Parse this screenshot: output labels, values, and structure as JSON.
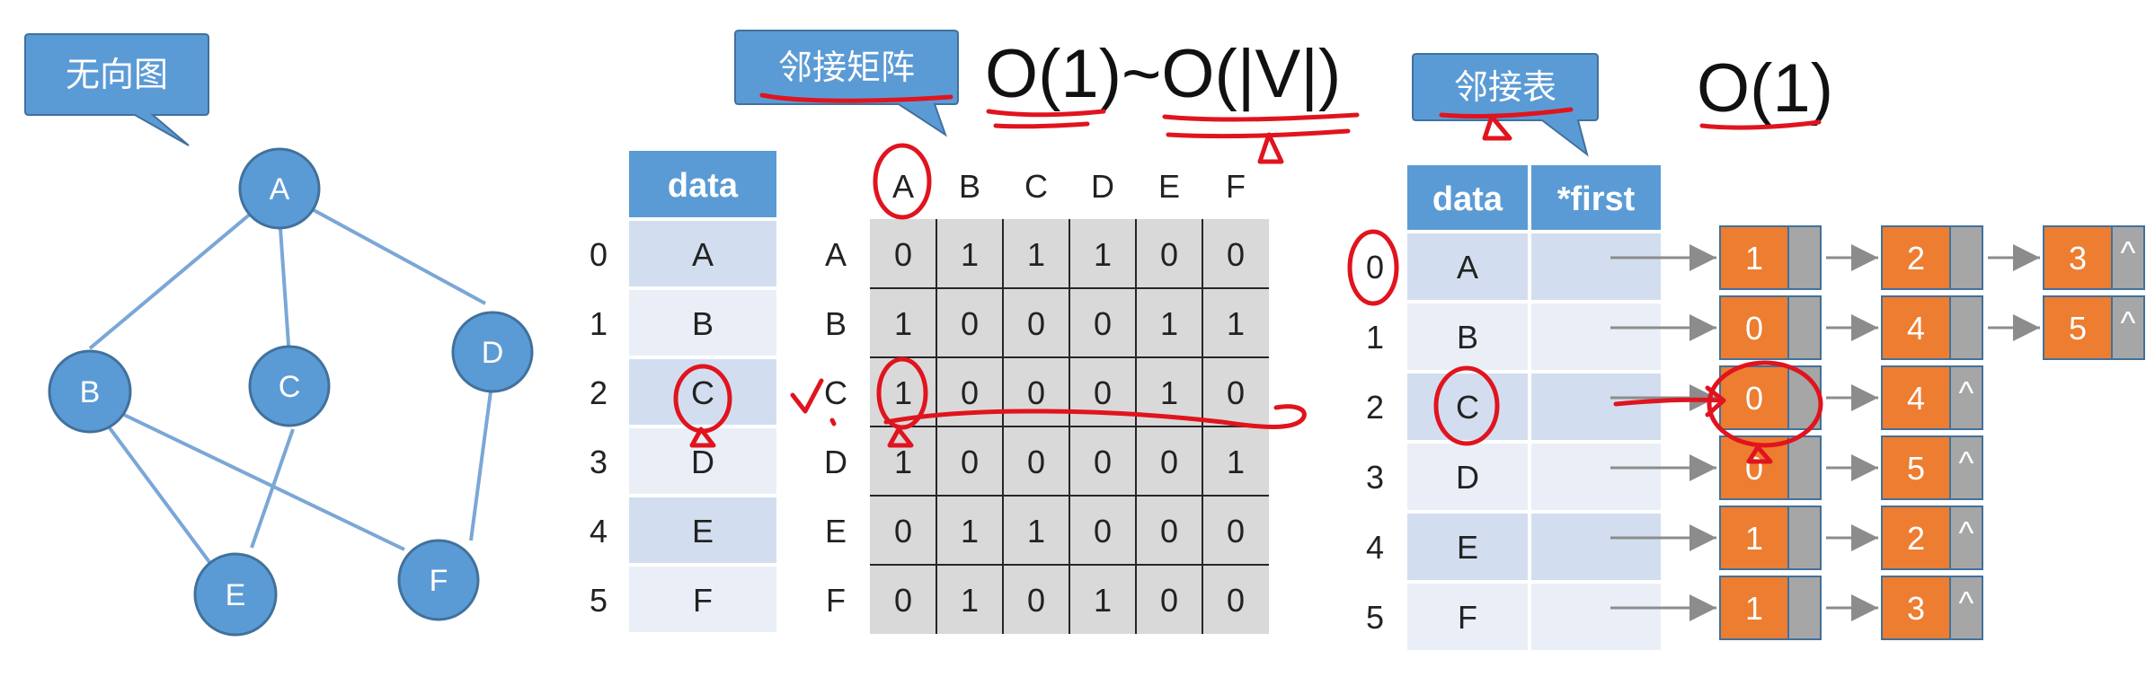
{
  "callouts": {
    "undirected_graph": "无向图",
    "adjacency_matrix": "邻接矩阵",
    "adjacency_list": "邻接表"
  },
  "complexity": {
    "matrix": "O(1)~O(|V|)",
    "list": "O(1)"
  },
  "graph": {
    "nodes": [
      "A",
      "B",
      "C",
      "D",
      "E",
      "F"
    ],
    "edges": [
      [
        "A",
        "B"
      ],
      [
        "A",
        "C"
      ],
      [
        "A",
        "D"
      ],
      [
        "B",
        "E"
      ],
      [
        "B",
        "F"
      ],
      [
        "C",
        "E"
      ],
      [
        "D",
        "F"
      ]
    ]
  },
  "vertex_table": {
    "header": "data",
    "indices": [
      "0",
      "1",
      "2",
      "3",
      "4",
      "5"
    ],
    "rows": [
      "A",
      "B",
      "C",
      "D",
      "E",
      "F"
    ]
  },
  "matrix": {
    "col_headers": [
      "A",
      "B",
      "C",
      "D",
      "E",
      "F"
    ],
    "row_headers": [
      "A",
      "B",
      "C",
      "D",
      "E",
      "F"
    ],
    "rows": [
      [
        "0",
        "1",
        "1",
        "1",
        "0",
        "0"
      ],
      [
        "1",
        "0",
        "0",
        "0",
        "1",
        "1"
      ],
      [
        "1",
        "0",
        "0",
        "0",
        "1",
        "0"
      ],
      [
        "1",
        "0",
        "0",
        "0",
        "0",
        "1"
      ],
      [
        "0",
        "1",
        "1",
        "0",
        "0",
        "0"
      ],
      [
        "0",
        "1",
        "0",
        "1",
        "0",
        "0"
      ]
    ]
  },
  "adj_list": {
    "headers": [
      "data",
      "*first"
    ],
    "indices": [
      "0",
      "1",
      "2",
      "3",
      "4",
      "5"
    ],
    "vertices": [
      "A",
      "B",
      "C",
      "D",
      "E",
      "F"
    ],
    "chains": [
      [
        "1",
        "2",
        "3"
      ],
      [
        "0",
        "4",
        "5"
      ],
      [
        "0",
        "4"
      ],
      [
        "0",
        "5"
      ],
      [
        "1",
        "2"
      ],
      [
        "1",
        "3"
      ]
    ],
    "null_mark": "^"
  },
  "colors": {
    "blue": "#5b9bd5",
    "orange": "#ed7d31",
    "gray": "#a6a6a6",
    "red_ink": "#e0141e"
  }
}
